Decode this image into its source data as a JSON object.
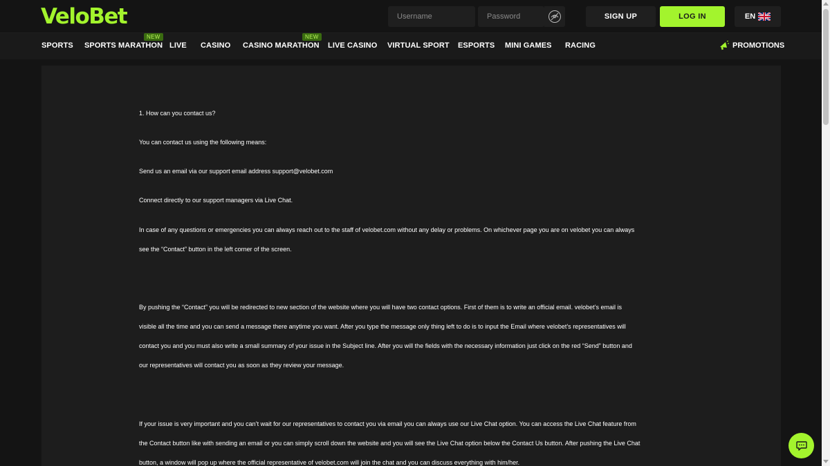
{
  "header": {
    "logo": "VeloBet",
    "username_placeholder": "Username",
    "password_placeholder": "Password",
    "signup_label": "SIGN UP",
    "login_label": "LOG IN",
    "language": "EN",
    "accent_color": "#a3f42d"
  },
  "nav": {
    "items": [
      {
        "label": "SPORTS"
      },
      {
        "label": "SPORTS MARATHON",
        "badge": "NEW"
      },
      {
        "label": "LIVE"
      },
      {
        "label": "CASINO"
      },
      {
        "label": "CASINO MARATHON",
        "badge": "NEW"
      },
      {
        "label": "LIVE CASINO"
      },
      {
        "label": "VIRTUAL SPORT"
      },
      {
        "label": "ESPORTS"
      },
      {
        "label": "MINI GAMES"
      },
      {
        "label": "RACING"
      }
    ],
    "promotions_label": "PROMOTIONS"
  },
  "content": {
    "paragraphs": [
      "1. How can you contact us?",
      "You can contact us using the following means:",
      "Send us an email via our support email address support@velobet.com",
      "Connect directly to our support managers via Live Chat.",
      "In case of any questions or emergencies you can always reach out to the staff of velobet.com without any delay or problems. On whichever page you are on velobet you can always",
      "see the “Contact” button in the left corner of the screen.",
      "By pushing the “Contact” you will be redirected to new section of the website where you will have two contact options. First of them is to write an official email. velobet’s email is",
      "visible all the time and you can send a message there anytime you want. After you type the message only thing left to do is to input the Email where velobet’s representatives will",
      "contact you and you must also write a small summary of your issue in the Subject line. After you will the fields with the necessary information just click on the red “Send” button and",
      "our representatives will contact you as soon as they review your message.",
      "If your issue is very important and you can’t wait for our representatives to contact you via email you can always use our Live Chat option. You can access the Live Chat feature from",
      "the Contact button like with sending an email or you can simply scroll down the website and you will see the Live Chat option below the Contact Us button. After pushing the Live Chat",
      "button, a window will pop up where the official representative of velobet.com will join the chat and you can discuss everything with him/her."
    ]
  },
  "icons": {
    "eye": "eye-slash-icon",
    "flag": "uk-flag-icon",
    "promo": "megaphone-icon",
    "chat": "chat-icon"
  }
}
